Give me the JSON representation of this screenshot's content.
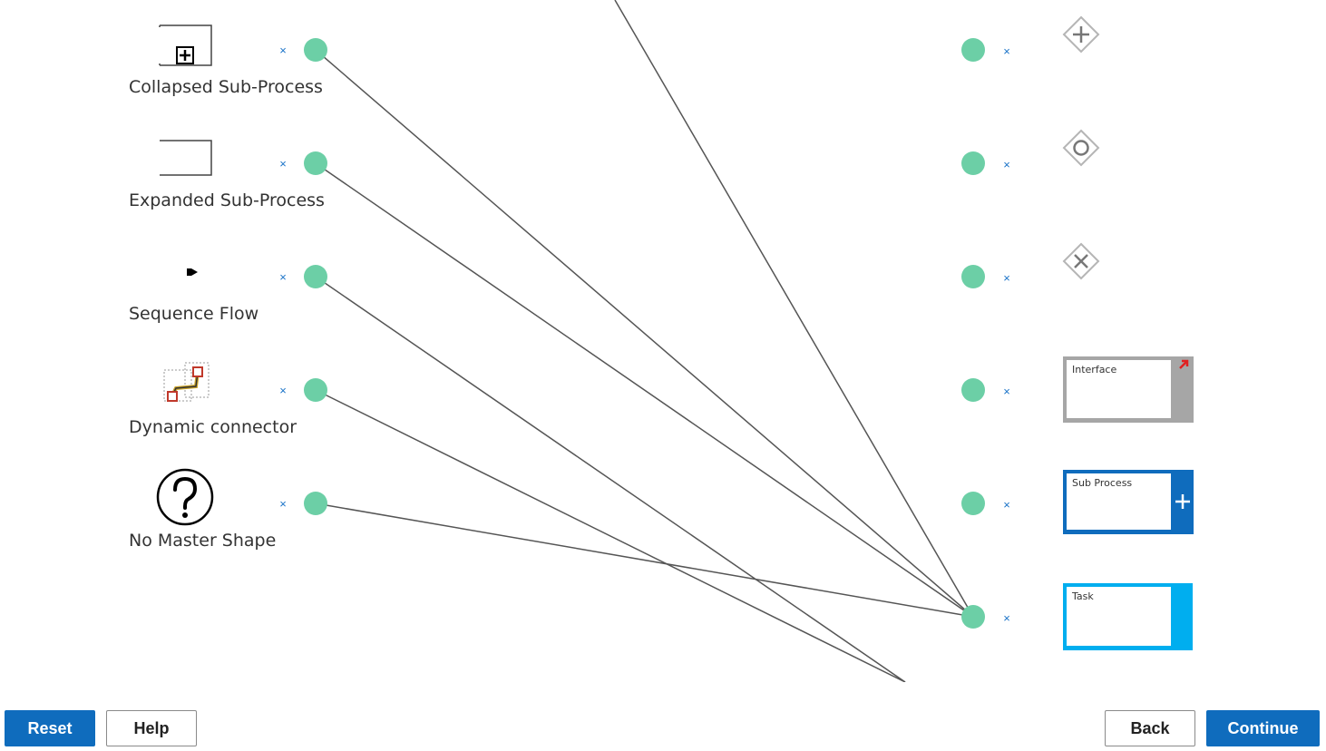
{
  "left_items": [
    {
      "label": "Collapsed Sub-Process",
      "icon": "collapsed-sub-process-icon"
    },
    {
      "label": "Expanded Sub-Process",
      "icon": "expanded-sub-process-icon"
    },
    {
      "label": "Sequence Flow",
      "icon": "sequence-flow-icon"
    },
    {
      "label": "Dynamic connector",
      "icon": "dynamic-connector-icon"
    },
    {
      "label": "No Master Shape",
      "icon": "question-mark-icon"
    }
  ],
  "right_items": [
    {
      "icon": "parallel-gateway-icon",
      "label": ""
    },
    {
      "icon": "inclusive-gateway-icon",
      "label": ""
    },
    {
      "icon": "exclusive-gateway-icon",
      "label": ""
    },
    {
      "icon": "interface-card-icon",
      "label": "Interface"
    },
    {
      "icon": "sub-process-card-icon",
      "label": "Sub Process"
    },
    {
      "icon": "task-card-icon",
      "label": "Task"
    }
  ],
  "remove_symbol": "×",
  "colors": {
    "dot": "#6ccfa6",
    "line": "#555555",
    "primary": "#0f6cbd",
    "remove": "#1a73c8",
    "interface_gray": "#a6a6a6",
    "sub_process_blue": "#0f6cbd",
    "task_cyan": "#00aeef"
  },
  "buttons": {
    "reset": "Reset",
    "help": "Help",
    "back": "Back",
    "continue": "Continue"
  }
}
